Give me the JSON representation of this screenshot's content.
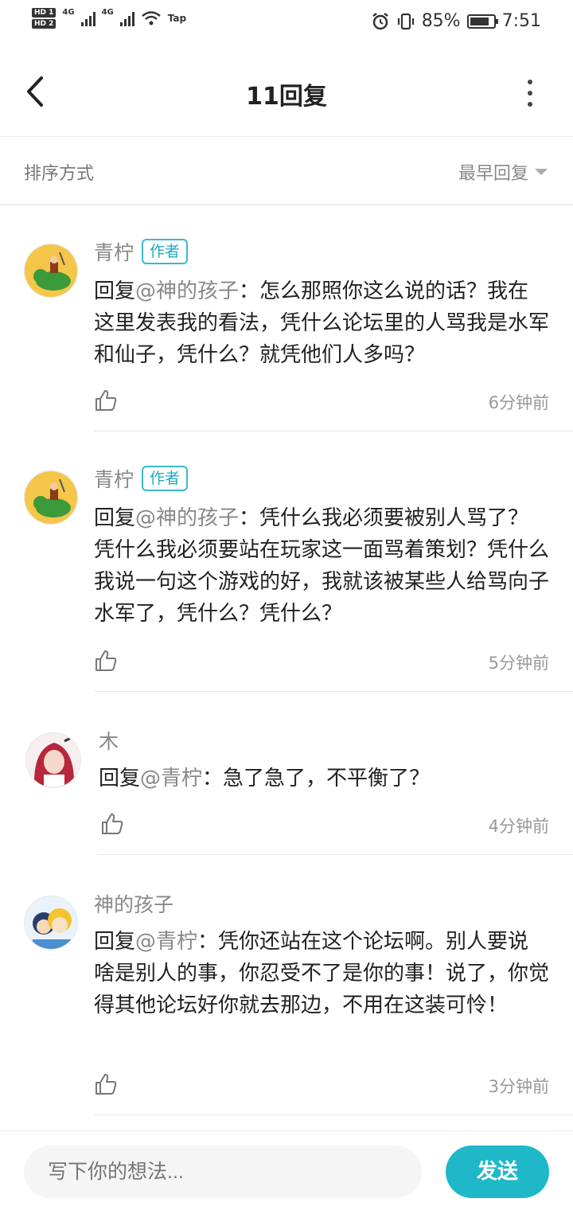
{
  "status_bar": {
    "hd1": "HD 1",
    "hd2": "HD 2",
    "net1": "4G",
    "net2": "4G",
    "tap": "Tap",
    "battery_percent": "85%",
    "battery_level": 0.85,
    "time": "7:51"
  },
  "header": {
    "title": "11回复",
    "back_icon": "chevron-left-icon",
    "more_icon": "more-vertical-icon"
  },
  "sort": {
    "label": "排序方式",
    "value": "最早回复"
  },
  "comments": [
    {
      "name": "青柠",
      "badge": "作者",
      "prefix": "回复",
      "mention": "@神的孩子",
      "text": "：怎么那照你这么说的话？我在这里发表我的看法，凭什么论坛里的人骂我是水军和仙子，凭什么？就凭他们人多吗？",
      "time": "6分钟前",
      "avatar": "dinosaur-rider-avatar"
    },
    {
      "name": "青柠",
      "badge": "作者",
      "prefix": "回复",
      "mention": "@神的孩子",
      "text": "：凭什么我必须要被别人骂了？凭什么我必须要站在玩家这一面骂着策划？凭什么我说一句这个游戏的好，我就该被某些人给骂向子水军了，凭什么？凭什么？",
      "time": "5分钟前",
      "avatar": "dinosaur-rider-avatar"
    },
    {
      "name": "木",
      "badge": "",
      "prefix": "回复",
      "mention": "@青柠",
      "text": "：急了急了，不平衡了？",
      "time": "4分钟前",
      "avatar": "anime-girl-avatar"
    },
    {
      "name": "神的孩子",
      "badge": "",
      "prefix": "回复",
      "mention": "@青柠",
      "text": "：凭你还站在这个论坛啊。别人要说啥是别人的事，你忍受不了是你的事！说了，你觉得其他论坛好你就去那边，不用在这装可怜！",
      "time": "3分钟前",
      "avatar": "cartoon-characters-avatar"
    }
  ],
  "composer": {
    "placeholder": "写下你的想法...",
    "send_label": "发送"
  },
  "colors": {
    "accent": "#1fb8c9",
    "badge": "#21a9c0",
    "muted": "#888888"
  }
}
